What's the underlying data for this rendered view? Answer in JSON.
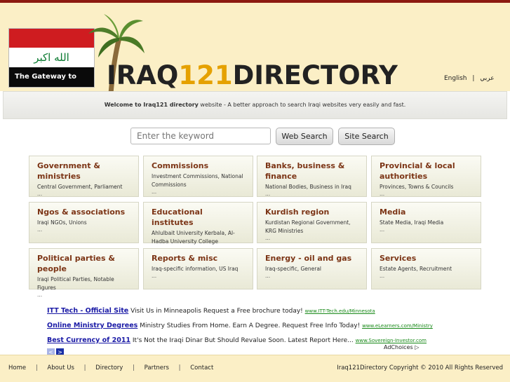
{
  "header": {
    "flag_text": "الله اكبر",
    "flag_caption": "The Gateway to Iraq",
    "logo_prefix": "IRAQ",
    "logo_number": "121",
    "logo_suffix": "DIRECTORY",
    "lang_english": "English",
    "lang_sep": "|",
    "lang_arabic": "عربي"
  },
  "welcome": {
    "bold": "Welcome to Iraq121 directory",
    "rest": " website - A better approach to search Iraqi websites very easily and fast."
  },
  "search": {
    "placeholder": "Enter the keyword",
    "web_search": "Web Search",
    "site_search": "Site Search"
  },
  "categories": [
    {
      "title": "Government & ministries",
      "desc": "Central Government, Parliament",
      "more": "..."
    },
    {
      "title": "Commissions",
      "desc": "Investment Commissions, National Commissions",
      "more": "..."
    },
    {
      "title": "Banks, business & finance",
      "desc": "National Bodies, Business in Iraq",
      "more": "..."
    },
    {
      "title": "Provincial & local authorities",
      "desc": "Provinces, Towns & Councils",
      "more": "..."
    },
    {
      "title": "Ngos & associations",
      "desc": "Iraqi NGOs, Unions",
      "more": "..."
    },
    {
      "title": "Educational institutes",
      "desc": "Ahlulbait University Kerbala, Al-Hadba University College",
      "more": "..."
    },
    {
      "title": "Kurdish region",
      "desc": "Kurdistan Regional Government, KRG Ministries",
      "more": "..."
    },
    {
      "title": "Media",
      "desc": "State Media, Iraqi Media",
      "more": "..."
    },
    {
      "title": "Political parties & people",
      "desc": "Iraqi Political Parties, Notable Figures",
      "more": "..."
    },
    {
      "title": "Reports & misc",
      "desc": "Iraq-specific information, US Iraq",
      "more": "..."
    },
    {
      "title": "Energy - oil and gas",
      "desc": "Iraq-specific, General",
      "more": "..."
    },
    {
      "title": "Services",
      "desc": "Estate Agents, Recruitment",
      "more": "..."
    }
  ],
  "ads": [
    {
      "headline": "ITT Tech - Official Site",
      "text": " Visit Us in Minneapolis Request a Free brochure today! ",
      "url": "www.ITT-Tech.edu/Minnesota"
    },
    {
      "headline": "Online Ministry Degrees",
      "text": " Ministry Studies From Home. Earn A Degree. Request Free Info Today! ",
      "url": "www.eLearners.com/Ministry"
    },
    {
      "headline": "Best Currency of 2011",
      "text": " It's Not the Iraqi Dinar But Should Revalue Soon. Latest Report Here... ",
      "url": "www.Sovereign-Investor.com"
    }
  ],
  "ad_nav": {
    "prev": "<",
    "next": ">",
    "adchoices": "AdChoices ▷"
  },
  "footer": {
    "links": [
      "Home",
      "About Us",
      "Directory",
      "Partners",
      "Contact"
    ],
    "sep": "|",
    "copyright": "Iraq121Directory Copyright © 2010 All Rights Reserved"
  }
}
